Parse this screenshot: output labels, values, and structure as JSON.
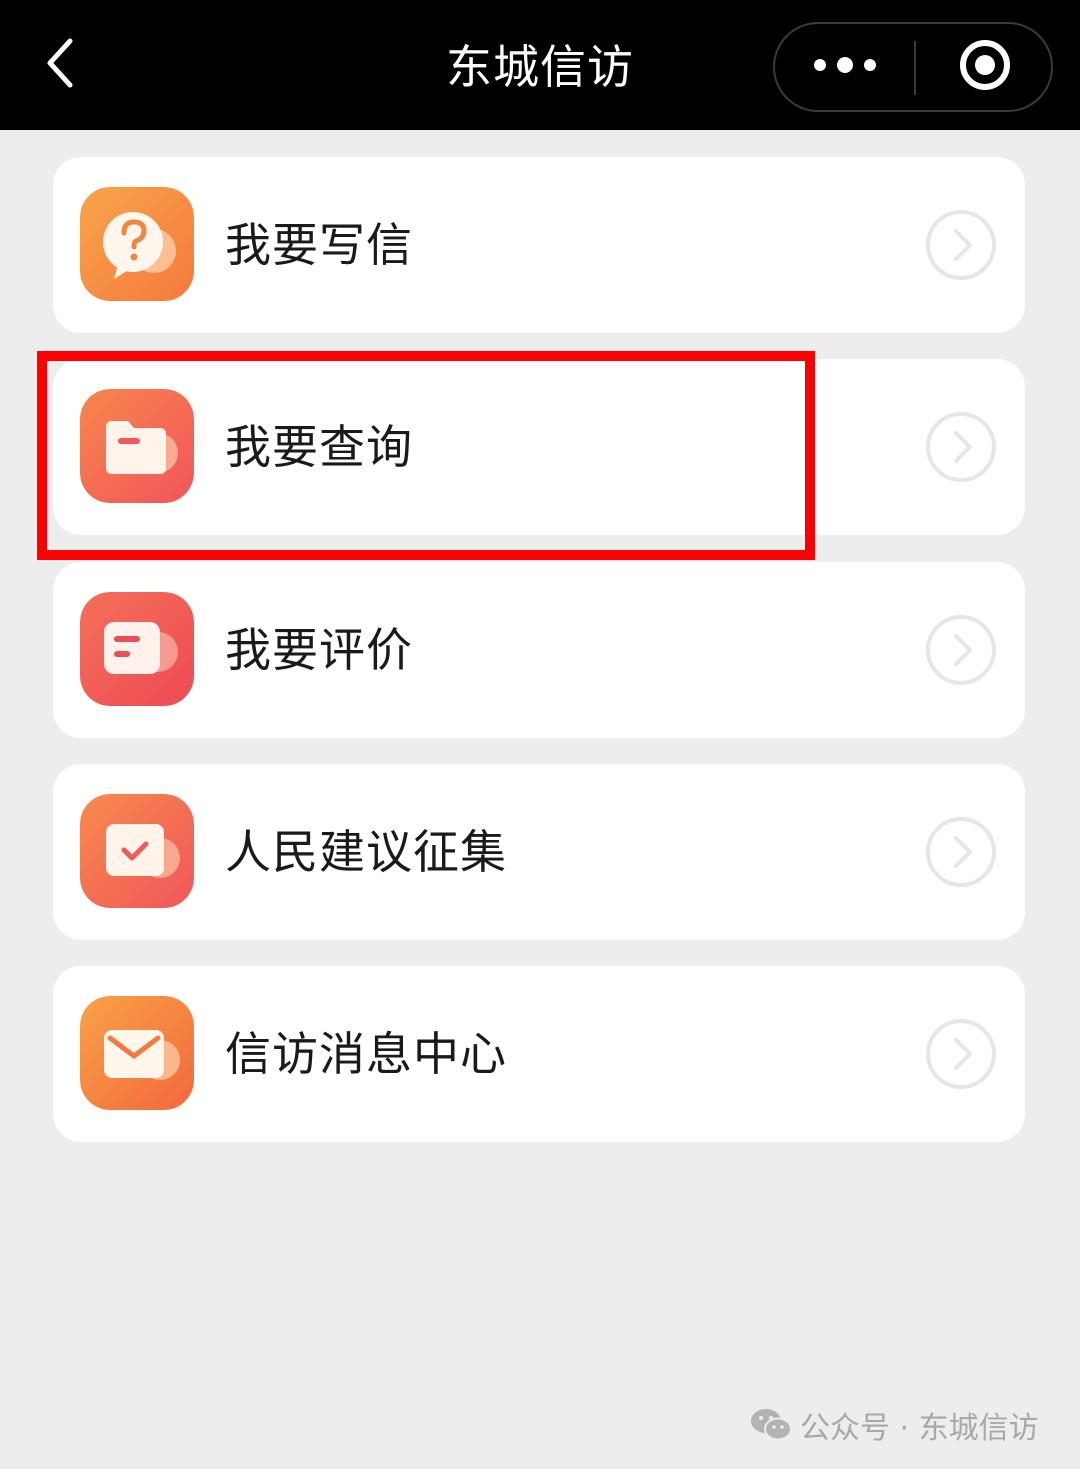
{
  "navbar": {
    "title": "东城信访",
    "back_icon": "chevron-left-icon",
    "more_icon": "more-dots-icon",
    "close_icon": "target-circle-icon"
  },
  "menu": {
    "items": [
      {
        "label": "我要写信",
        "icon": "question-bubble-icon",
        "color_from": "#f9a44a",
        "color_to": "#f47a3e"
      },
      {
        "label": "我要查询",
        "icon": "folder-icon",
        "color_from": "#f7874d",
        "color_to": "#f2545a"
      },
      {
        "label": "我要评价",
        "icon": "comment-card-icon",
        "color_from": "#f47058",
        "color_to": "#ee4a55"
      },
      {
        "label": "人民建议征集",
        "icon": "checkbox-card-icon",
        "color_from": "#f88a4d",
        "color_to": "#f0565a"
      },
      {
        "label": "信访消息中心",
        "icon": "envelope-icon",
        "color_from": "#f9a246",
        "color_to": "#f3683f"
      }
    ],
    "highlighted_index": 1,
    "highlight_color": "#ff0000"
  },
  "watermark": {
    "text": "公众号 · 东城信访",
    "icon": "wechat-icon"
  }
}
